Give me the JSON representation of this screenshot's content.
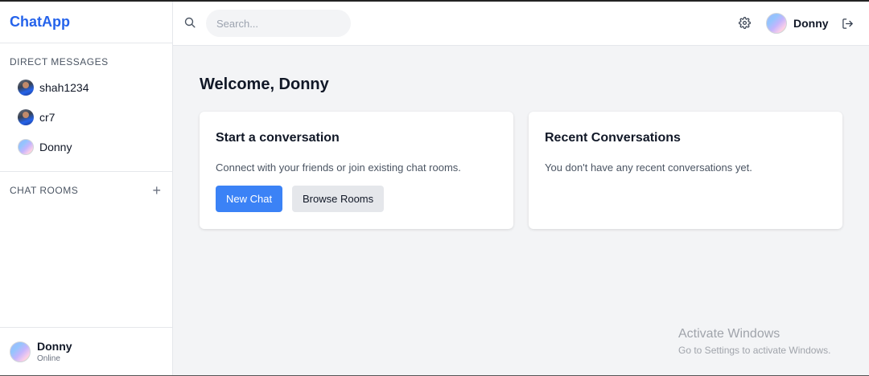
{
  "app": {
    "brand": "ChatApp"
  },
  "sidebar": {
    "direct_messages_title": "DIRECT MESSAGES",
    "direct_messages": [
      {
        "name": "shah1234",
        "avatar": "photo"
      },
      {
        "name": "cr7",
        "avatar": "photo"
      },
      {
        "name": "Donny",
        "avatar": "gradient"
      }
    ],
    "chat_rooms_title": "CHAT ROOMS",
    "add_room_symbol": "+",
    "current_user": {
      "name": "Donny",
      "status": "Online"
    }
  },
  "header": {
    "search_placeholder": "Search...",
    "user_name": "Donny"
  },
  "main": {
    "welcome": "Welcome, Donny",
    "start_card": {
      "title": "Start a conversation",
      "text": "Connect with your friends or join existing chat rooms.",
      "new_chat_label": "New Chat",
      "browse_rooms_label": "Browse Rooms"
    },
    "recent_card": {
      "title": "Recent Conversations",
      "text": "You don't have any recent conversations yet."
    }
  },
  "watermark": {
    "title": "Activate Windows",
    "subtitle": "Go to Settings to activate Windows."
  },
  "colors": {
    "brand": "#2563eb",
    "primary_button": "#3b82f6",
    "secondary_button": "#e5e7eb",
    "background": "#f3f4f6"
  },
  "icons": [
    "search-icon",
    "gear-icon",
    "logout-icon",
    "plus-icon"
  ]
}
